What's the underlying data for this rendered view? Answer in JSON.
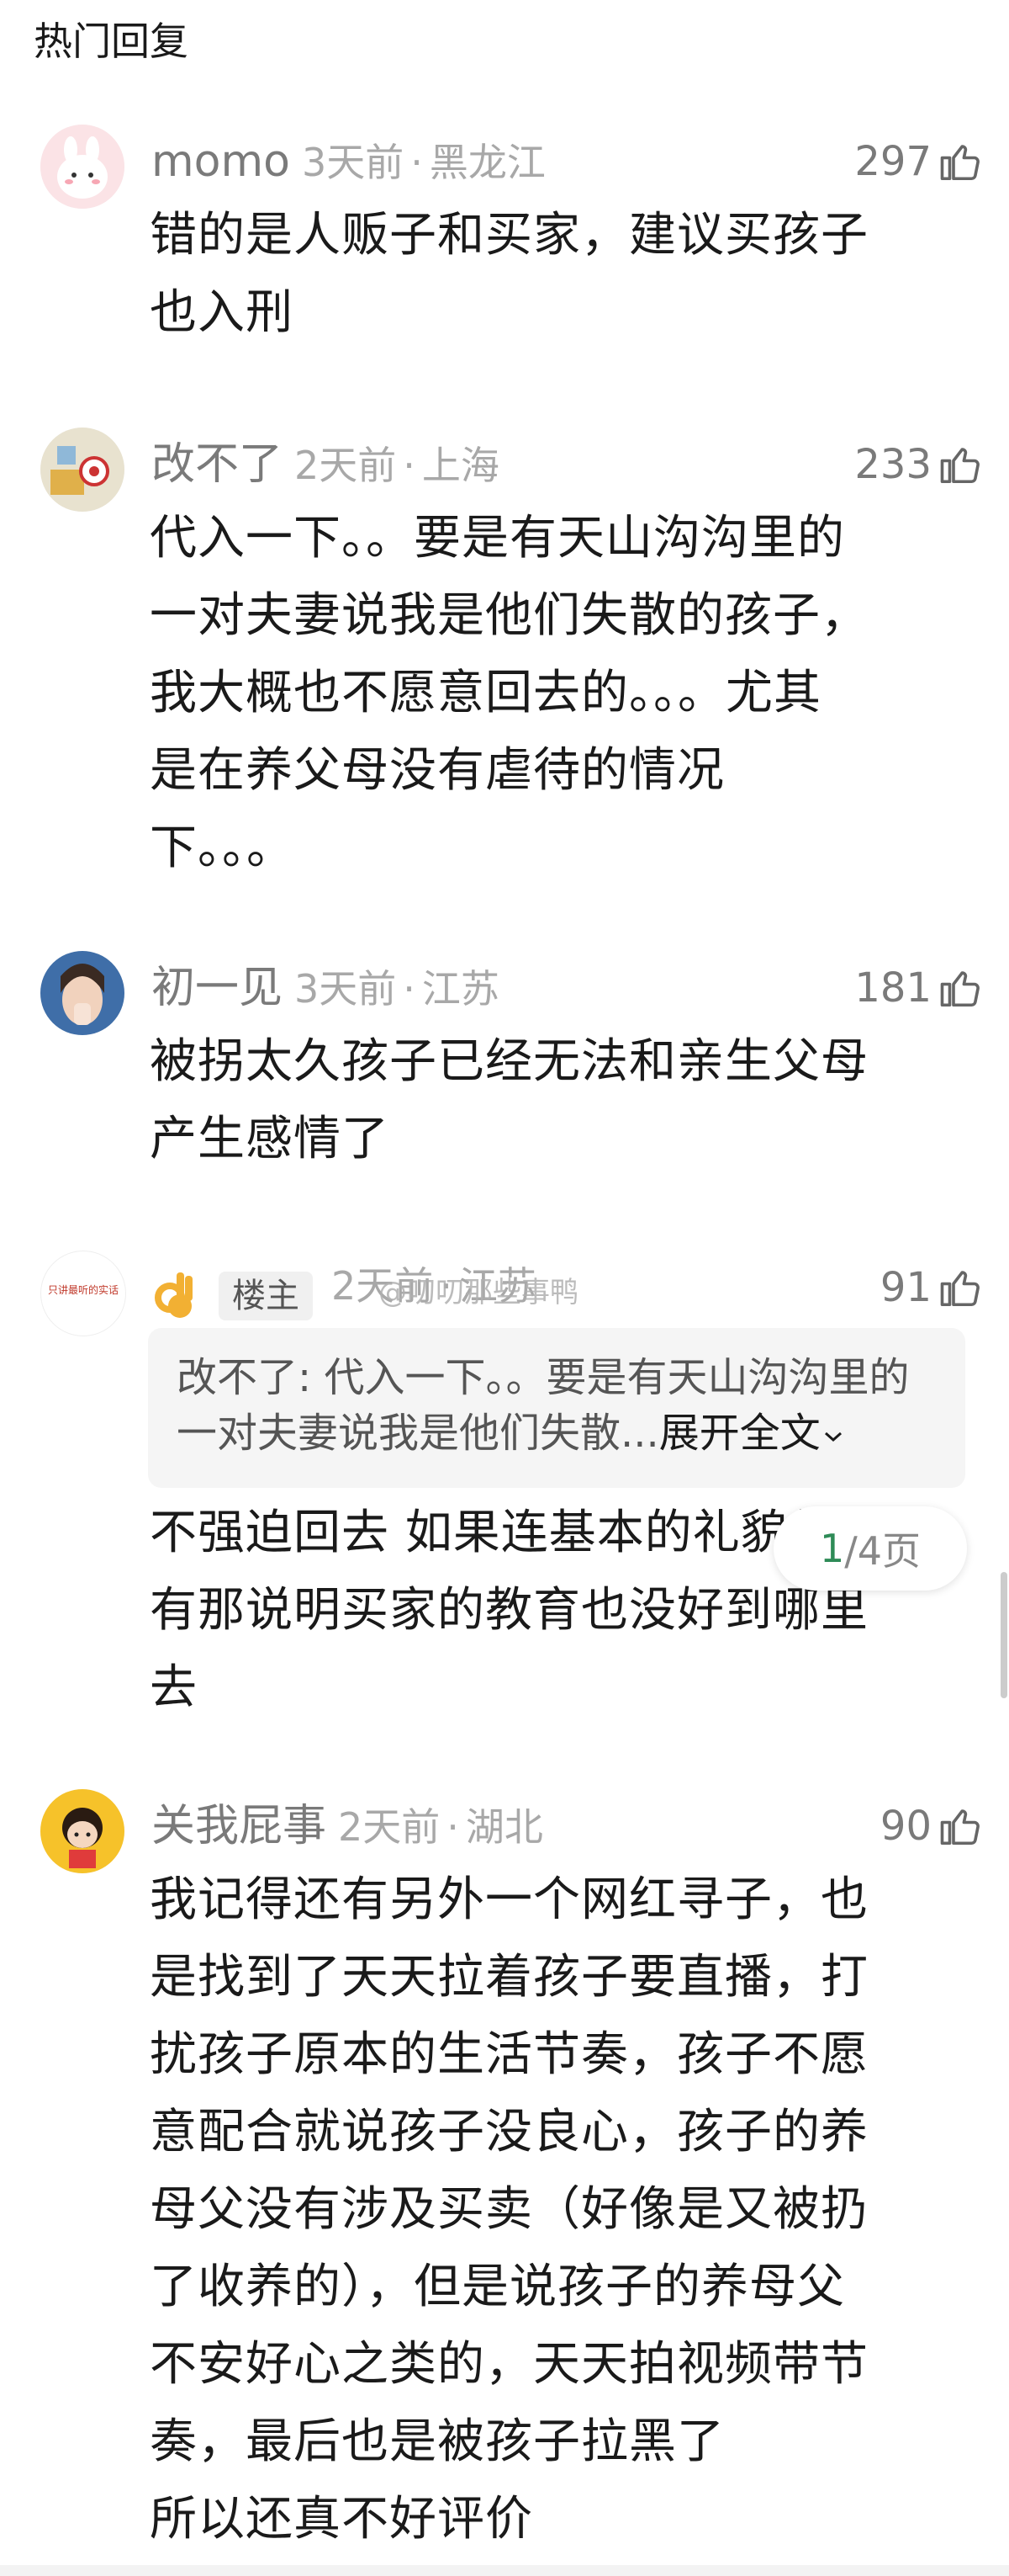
{
  "section_title": "热门回复",
  "comments": [
    {
      "name": "momo",
      "time": "3天前",
      "location": "黑龙江",
      "likes": "297",
      "text": "错的是人贩子和买家，建议买孩子\n也入刑",
      "avatar": "pink-bunny-avatar"
    },
    {
      "name": "改不了",
      "time": "2天前",
      "location": "上海",
      "likes": "233",
      "text": "代入一下。。要是有天山沟沟里的\n一对夫妻说我是他们失散的孩子，\n我大概也不愿意回去的。。。尤其\n是在养父母没有虐待的情况\n下。。。",
      "avatar": "cartoon-scene-avatar"
    },
    {
      "name": "初一见",
      "time": "3天前",
      "location": "江苏",
      "likes": "181",
      "text": "被拐太久孩子已经无法和亲生父母\n产生感情了",
      "avatar": "woman-photo-avatar"
    },
    {
      "name": "👌",
      "badge": "楼主",
      "time": "2天前",
      "location": "江苏",
      "likes": "91",
      "quote_author": "改不了",
      "quote_text": "代入一下。。要是有天山沟沟里的一对夫妻说我是他们失散...",
      "quote_expand": "展开全文",
      "text": "不强迫回去 如果连基本的礼貌都没\n有那说明买家的教育也没好到哪里\n去",
      "avatar": "text-logo-avatar",
      "avatar_text": "只讲最听的实话",
      "watermark": "@叨叨那些事鸭"
    },
    {
      "name": "关我屁事",
      "time": "2天前",
      "location": "湖北",
      "likes": "90",
      "text": "我记得还有另外一个网红寻子，也\n是找到了天天拉着孩子要直播，打\n扰孩子原本的生活节奏，孩子不愿\n意配合就说孩子没良心，孩子的养\n母父没有涉及买卖（好像是又被扔\n了收养的），但是说孩子的养母父\n不安好心之类的，天天拍视频带节\n奏，最后也是被孩子拉黑了\n所以还真不好评价",
      "avatar": "cartoon-girl-avatar"
    }
  ],
  "pagination": {
    "current": "1",
    "rest": "/4页"
  },
  "colors": {
    "text": "#1a1a1a",
    "meta": "#a8a8a8",
    "name": "#7a7a7a",
    "accent": "#2e8b57"
  }
}
